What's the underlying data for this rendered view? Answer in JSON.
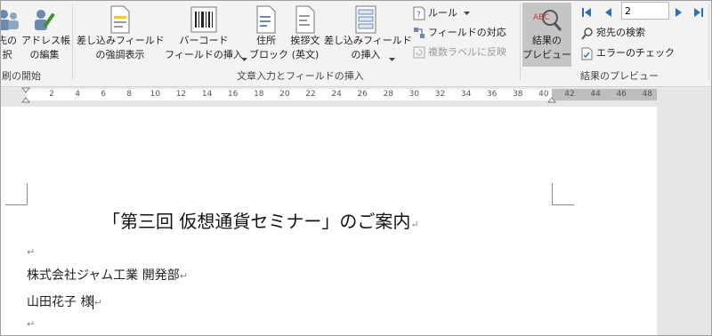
{
  "ribbon": {
    "partial_left_top": "先の",
    "partial_left_bottom": "択",
    "address_book_top": "アドレス帳",
    "address_book_bottom": "の編集",
    "highlight_fields_top": "差し込みフィールド",
    "highlight_fields_bottom": "の強調表示",
    "barcode_top": "バーコード",
    "barcode_bottom": "フィールドの挿入",
    "address_block_top": "住所",
    "address_block_bottom": "ブロック",
    "greeting_top": "挨拶文",
    "greeting_bottom": "(英文)",
    "insert_merge_top": "差し込みフィールド",
    "insert_merge_bottom": "の挿入",
    "rules": "ルール",
    "match_fields": "フィールドの対応",
    "update_labels": "複数ラベルに反映",
    "preview_top": "結果の",
    "preview_bottom": "プレビュー",
    "record_number": "2",
    "find_recipient": "宛先の検索",
    "check_errors": "エラーのチェック",
    "group_start": "刷の開始",
    "group_write_insert": "文章入力とフィールドの挿入",
    "group_preview": "結果のプレビュー",
    "preview_badge": "ABC"
  },
  "ruler": {
    "ticks": [
      "2",
      "4",
      "6",
      "8",
      "10",
      "12",
      "14",
      "16",
      "18",
      "20",
      "22",
      "24",
      "26",
      "28",
      "30",
      "32",
      "34",
      "36",
      "38",
      "40",
      "42",
      "44",
      "46",
      "48"
    ]
  },
  "document": {
    "title": "「第三回 仮想通貨セミナー」のご案内",
    "company": "株式会社ジャム工業 開発部",
    "recipient": "山田花子 様",
    "paragraph_mark": "↵"
  }
}
